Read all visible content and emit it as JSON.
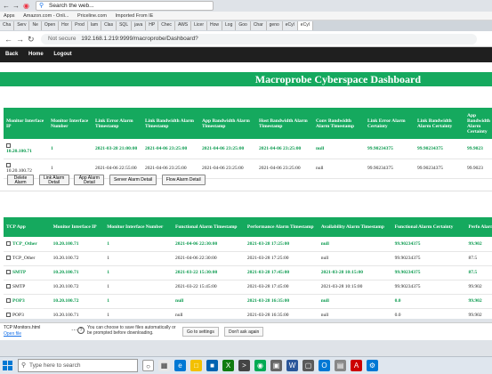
{
  "browser": {
    "search_text": "Search the web...",
    "bookmarks": [
      "Apps",
      "Amazon.com - Onli...",
      "Priceline.com",
      "Imported From IE"
    ],
    "tabs": [
      "Cha",
      "Serv",
      "Ne",
      "Open",
      "Hor",
      "Prod",
      "Iam",
      "Clas",
      "SQL",
      "java",
      "HP",
      "Chec",
      "AWS",
      "Licer",
      "How",
      "Log",
      "Goo",
      "Char",
      "geno",
      "eCyl",
      "eCyl"
    ],
    "not_secure": "Not secure",
    "url": "192.168.1.219:9999/macroprobe/Dashboard?"
  },
  "app": {
    "nav": [
      "Back",
      "Home",
      "Logout"
    ],
    "title": "Macroprobe Cyberspace Dashboard"
  },
  "link_table": {
    "headers": [
      "Monitor Interface IP",
      "Monitor Interface Number",
      "Link Error Alarm Timestamp",
      "Link Bandwidth Alarm Timestamp",
      "App Bandwidth Alarm Timestamp",
      "Host Bandwidth Alarm Timestamp",
      "Conv Bandwidth Alarm Timestamp",
      "Link Error Alarm Certainty",
      "Link Bandwidth Alarm Certainty",
      "App Bandwidth Alarm Certainty"
    ],
    "rows": [
      {
        "ip": "10.20.100.71",
        "num": "1",
        "link_err": "2021-03-28 21:00:00",
        "link_bw": "2021-04-06 23:25:00",
        "app_bw": "2021-04-06 23:25:00",
        "host_bw": "2021-04-06 23:25:00",
        "conv_bw": "null",
        "c1": "99.90234375",
        "c2": "99.90234375",
        "c3": "99.9023"
      },
      {
        "ip": "10.20.100.72",
        "num": "1",
        "link_err": "2021-04-06 22:55:00",
        "link_bw": "2021-04-06 23:25:00",
        "app_bw": "2021-04-06 23:25:00",
        "host_bw": "2021-04-06 23:25:00",
        "conv_bw": "null",
        "c1": "99.90234375",
        "c2": "99.90234375",
        "c3": "99.9023"
      }
    ]
  },
  "buttons": [
    "Delete Alarm",
    "Link Alarm Detail",
    "App Alarm Detail",
    "Server Alarm Detail",
    "Flow Alarm Detail"
  ],
  "tcp_table": {
    "headers": [
      "TCP App",
      "Monitor Interface IP",
      "Monitor Interface Number",
      "Functional Alarm Timestamp",
      "Performance Alarm Timestamp",
      "Availability Alarm Timestamp",
      "Functional Alarm Certainty",
      "Perfo Alarm C"
    ],
    "rows": [
      {
        "app": "TCP_Other",
        "ip": "10.20.100.71",
        "num": "1",
        "func": "2021-04-06 22:30:00",
        "perf": "2021-03-28 17:25:00",
        "avail": "null",
        "fcert": "99.90234375",
        "pcert": "99.902"
      },
      {
        "app": "TCP_Other",
        "ip": "10.20.100.72",
        "num": "1",
        "func": "2021-04-06 22:30:00",
        "perf": "2021-03-28 17:25:00",
        "avail": "null",
        "fcert": "99.90234375",
        "pcert": "87.5"
      },
      {
        "app": "SMTP",
        "ip": "10.20.100.71",
        "num": "1",
        "func": "2021-03-22 15:30:00",
        "perf": "2021-03-28 17:45:00",
        "avail": "2021-03-28 10:15:00",
        "fcert": "99.90234375",
        "pcert": "87.5"
      },
      {
        "app": "SMTP",
        "ip": "10.20.100.72",
        "num": "1",
        "func": "2021-03-22 15:45:00",
        "perf": "2021-03-28 17:45:00",
        "avail": "2021-03-28 10:15:00",
        "fcert": "99.90234375",
        "pcert": "99.902"
      },
      {
        "app": "POP3",
        "ip": "10.20.100.72",
        "num": "1",
        "func": "null",
        "perf": "2021-03-28 16:35:00",
        "avail": "null",
        "fcert": "0.0",
        "pcert": "99.902"
      },
      {
        "app": "POP3",
        "ip": "10.20.100.71",
        "num": "1",
        "func": "null",
        "perf": "2021-03-28 16:35:00",
        "avail": "null",
        "fcert": "0.0",
        "pcert": "99.902"
      }
    ]
  },
  "download": {
    "file": "TCP Monitors.html",
    "open": "Open file",
    "warning": "You can choose to save files automatically or be prompted before downloading.",
    "settings": "Go to settings",
    "dismiss": "Don't ask again"
  },
  "taskbar": {
    "search_placeholder": "Type here to search"
  }
}
